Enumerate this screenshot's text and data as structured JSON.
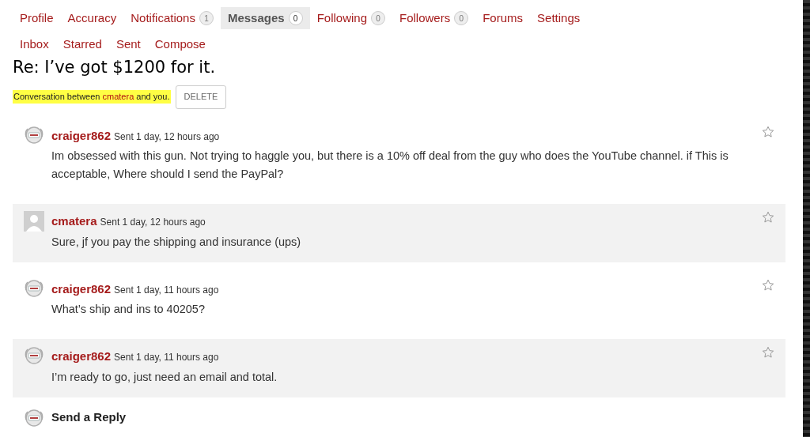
{
  "tabs": [
    {
      "label": "Profile",
      "selected": false
    },
    {
      "label": "Accuracy",
      "selected": false
    },
    {
      "label": "Notifications",
      "count": "1",
      "selected": false
    },
    {
      "label": "Messages",
      "count": "0",
      "selected": true
    },
    {
      "label": "Following",
      "count": "0",
      "selected": false
    },
    {
      "label": "Followers",
      "count": "0",
      "selected": false
    },
    {
      "label": "Forums",
      "selected": false
    },
    {
      "label": "Settings",
      "selected": false
    }
  ],
  "subtabs": [
    "Inbox",
    "Starred",
    "Sent",
    "Compose"
  ],
  "title": "Re: I’ve got $1200 for it.",
  "conversation": {
    "prefix": "Conversation between",
    "user": "cmatera",
    "suffix": "and you.",
    "delete_button": "DELETE"
  },
  "messages": [
    {
      "avatar": {
        "kind": "badge"
      },
      "author": "craiger862",
      "time": "Sent 1 day, 12 hours ago",
      "body": "Im obsessed with this gun. Not trying to haggle you, but there is a 10% off deal from the guy who does the YouTube channel.  if This is acceptable, Where should I send the PayPal?",
      "shaded": false,
      "starred": false
    },
    {
      "avatar": {
        "kind": "default"
      },
      "author": "cmatera",
      "time": "Sent 1 day, 12 hours ago",
      "body": "Sure, jf you pay the shipping and insurance (ups)",
      "shaded": true,
      "starred": false
    },
    {
      "avatar": {
        "kind": "badge"
      },
      "author": "craiger862",
      "time": "Sent 1 day, 11 hours ago",
      "body": "What’s ship and ins to 40205?",
      "shaded": false,
      "starred": false
    },
    {
      "avatar": {
        "kind": "badge"
      },
      "author": "craiger862",
      "time": "Sent 1 day, 11 hours ago",
      "body": "I’m ready to go, just need an email and total.",
      "shaded": true,
      "starred": false
    }
  ],
  "reply": {
    "avatar": {
      "kind": "badge"
    },
    "title": "Send a Reply"
  }
}
